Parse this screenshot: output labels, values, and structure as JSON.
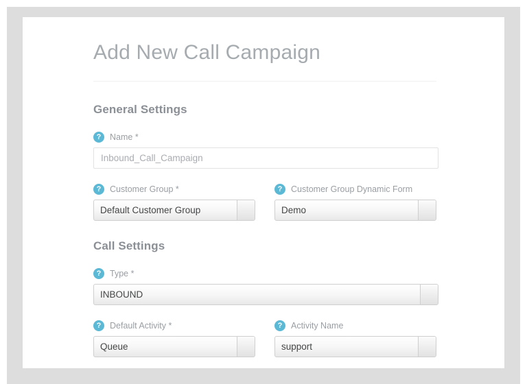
{
  "page": {
    "title": "Add New Call Campaign"
  },
  "icons": {
    "help": "?",
    "help_icon_name": "help-circle-icon",
    "help_color": "#5cb9d6"
  },
  "sections": [
    {
      "id": "general",
      "title": "General Settings",
      "rows": [
        {
          "fields": [
            {
              "id": "name",
              "label": "Name *",
              "control": "text",
              "value": "Inbound_Call_Campaign",
              "placeholder": "Inbound_Call_Campaign",
              "width": "full"
            }
          ]
        },
        {
          "fields": [
            {
              "id": "customer-group",
              "label": "Customer Group *",
              "control": "select",
              "value": "Default Customer Group",
              "width": "half"
            },
            {
              "id": "customer-group-dynamic-form",
              "label": "Customer Group Dynamic Form",
              "control": "select",
              "value": "Demo",
              "width": "half"
            }
          ]
        }
      ]
    },
    {
      "id": "call",
      "title": "Call Settings",
      "rows": [
        {
          "fields": [
            {
              "id": "type",
              "label": "Type *",
              "control": "select",
              "value": "INBOUND",
              "width": "full"
            }
          ]
        },
        {
          "fields": [
            {
              "id": "default-activity",
              "label": "Default Activity *",
              "control": "select",
              "value": "Queue",
              "width": "half"
            },
            {
              "id": "activity-name",
              "label": "Activity Name",
              "control": "select",
              "value": "support",
              "width": "half"
            }
          ]
        }
      ]
    }
  ]
}
